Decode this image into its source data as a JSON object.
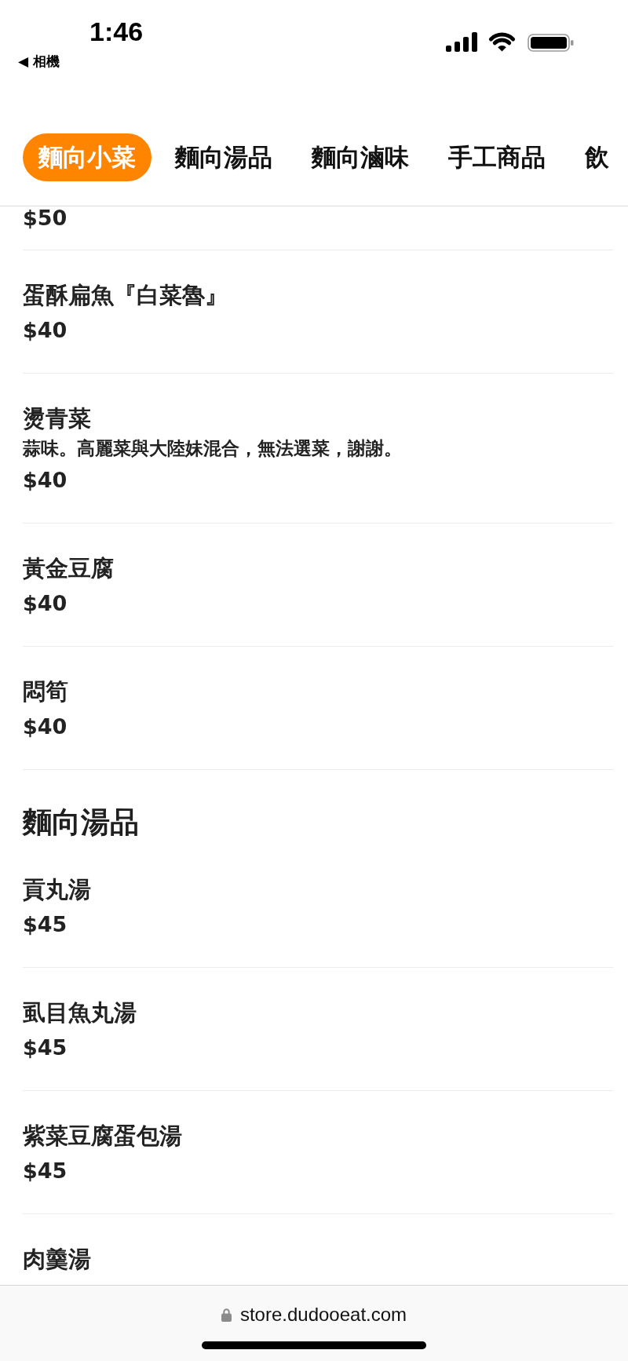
{
  "status_bar": {
    "time": "1:46",
    "back_link": "◀ 相機"
  },
  "tabs": [
    {
      "label": "麵向小菜",
      "selected": true
    },
    {
      "label": "麵向湯品",
      "selected": false
    },
    {
      "label": "麵向滷味",
      "selected": false
    },
    {
      "label": "手工商品",
      "selected": false
    },
    {
      "label": "飲",
      "selected": false
    }
  ],
  "sections": [
    {
      "items": [
        {
          "price": "$50"
        },
        {
          "name": "蛋酥扁魚『白菜魯』",
          "price": "$40"
        },
        {
          "name": "燙青菜",
          "description": "蒜味。高麗菜與大陸妹混合，無法選菜，謝謝。",
          "price": "$40"
        },
        {
          "name": "黃金豆腐",
          "price": "$40"
        },
        {
          "name": "悶筍",
          "price": "$40"
        }
      ]
    },
    {
      "title": "麵向湯品",
      "items": [
        {
          "name": "貢丸湯",
          "price": "$45"
        },
        {
          "name": "虱目魚丸湯",
          "price": "$45"
        },
        {
          "name": "紫菜豆腐蛋包湯",
          "price": "$45"
        },
        {
          "name": "肉羹湯"
        }
      ]
    }
  ],
  "browser_bar": {
    "url": "store.dudooeat.com"
  }
}
